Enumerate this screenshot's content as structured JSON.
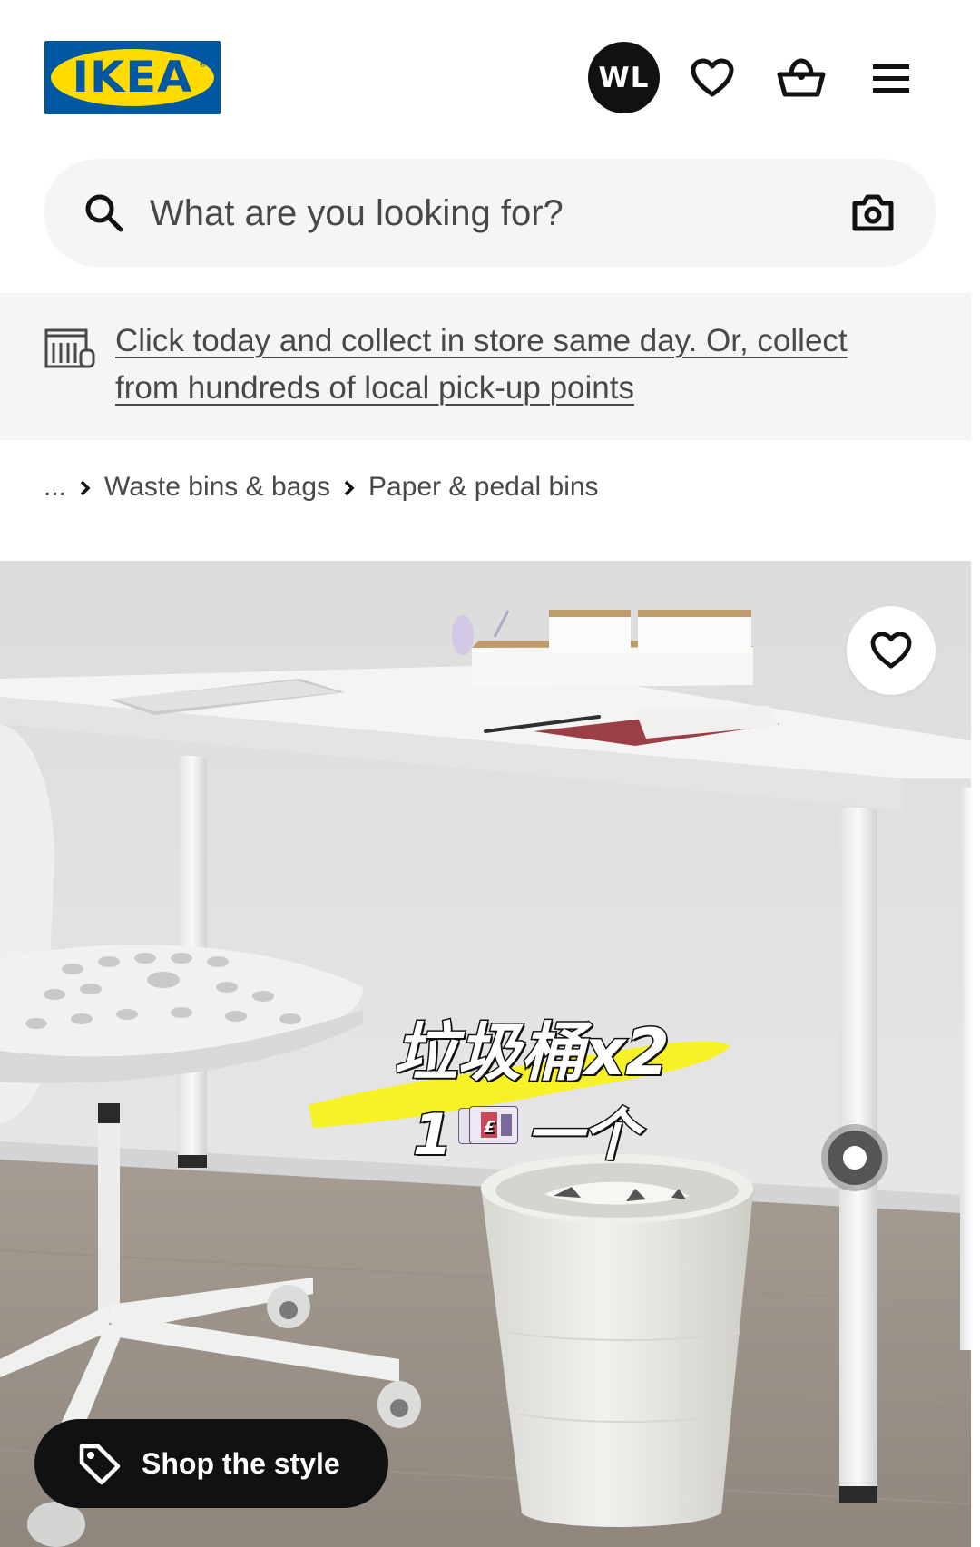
{
  "header": {
    "logo_text": "IKEA",
    "avatar_initials": "WL",
    "icons": [
      "heart-icon",
      "shopping-basket-icon",
      "hamburger-menu-icon"
    ]
  },
  "search": {
    "placeholder": "What are you looking for?",
    "icons": [
      "search-icon",
      "camera-icon"
    ]
  },
  "banner": {
    "line1": "Click today and collect in store same day. Or, collect",
    "line2": "from hundreds of local pick-up points",
    "icon": "store-pickup-icon"
  },
  "breadcrumb": {
    "items": [
      "...",
      "Waste bins & bags",
      "Paper & pedal bins"
    ]
  },
  "hero": {
    "sticker_line1": "垃圾桶x2",
    "sticker_line2_prefix": "1",
    "sticker_line2_suffix": "一个",
    "shop_the_style": "Shop the style",
    "icons": [
      "favourite-heart-icon",
      "tag-icon",
      "hotspot-dot"
    ]
  },
  "colors": {
    "ikea_blue": "#0058a3",
    "ikea_yellow": "#ffdb00",
    "panel_grey": "#f5f5f5",
    "text_dark": "#111111",
    "text_grey": "#484848",
    "highlighter_yellow": "#f7f21a"
  }
}
